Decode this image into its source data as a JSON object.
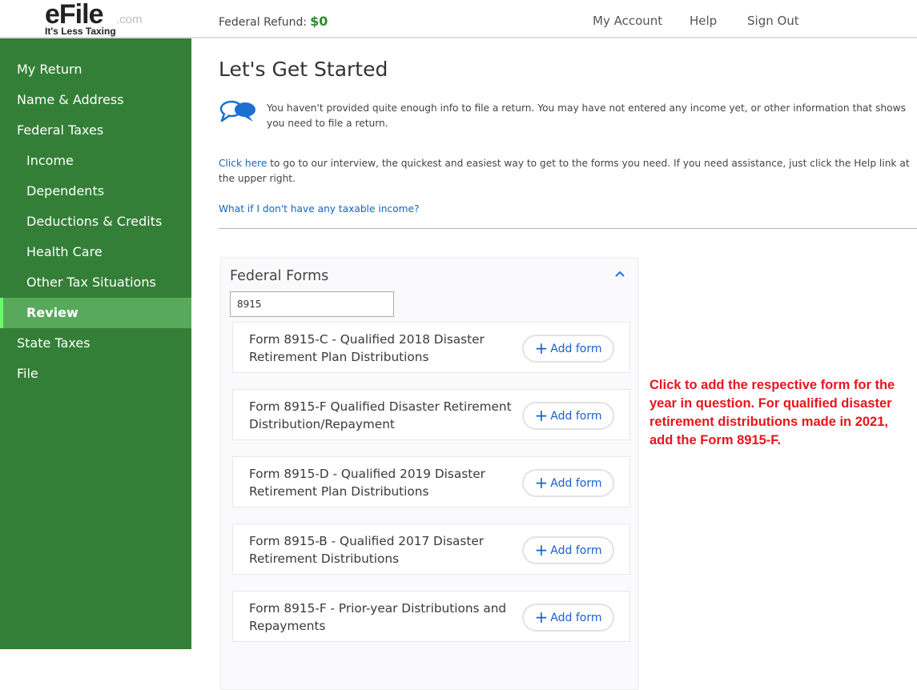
{
  "header": {
    "logo_text": "eFile",
    "logo_suffix": ".com",
    "logo_tagline": "It's Less Taxing",
    "refund_label": "Federal Refund:",
    "refund_amount": "$0",
    "nav": [
      "My Account",
      "Help",
      "Sign Out"
    ]
  },
  "sidebar": {
    "items": [
      {
        "label": "My Return"
      },
      {
        "label": "Name & Address"
      },
      {
        "label": "Federal Taxes"
      },
      {
        "label": "Income"
      },
      {
        "label": "Dependents"
      },
      {
        "label": "Deductions & Credits"
      },
      {
        "label": "Health Care"
      },
      {
        "label": "Other Tax Situations"
      },
      {
        "label": "Review"
      },
      {
        "label": "State Taxes"
      },
      {
        "label": "File"
      }
    ],
    "active": "Review"
  },
  "main": {
    "title": "Let's Get Started",
    "notice": "You haven't provided quite enough info to file a return. You may have not entered any income yet, or other information that shows you need to file a return.",
    "click_here": "Click here",
    "para_rest": " to go to our interview, the quickest and easiest way to get to the forms you need. If you need assistance, just click the Help link at the upper right.",
    "no_income_link": "What if I don't have any taxable income?",
    "forms_panel": {
      "title": "Federal Forms",
      "search_value": "8915",
      "add_label": "Add form",
      "forms": [
        {
          "name": "Form 8915-C - Qualified 2018 Disaster Retirement Plan Distributions"
        },
        {
          "name": "Form 8915-F Qualified Disaster Retirement Distribution/Repayment"
        },
        {
          "name": "Form 8915-D - Qualified 2019 Disaster Retirement Plan Distributions"
        },
        {
          "name": "Form 8915-B - Qualified 2017 Disaster Retirement Distributions"
        },
        {
          "name": "Form 8915-F - Prior-year Distributions and Repayments"
        }
      ]
    }
  },
  "annotation": "Click to add the respective form for the year in question. For qualified disaster retirement distributions made in 2021, add the Form 8915-F.",
  "colors": {
    "sidebar_bg": "#337f37",
    "sidebar_active": "#58a95c",
    "refund_green": "#2e8b2e",
    "link_blue": "#1565c0",
    "annotation_red": "#e8141d"
  }
}
